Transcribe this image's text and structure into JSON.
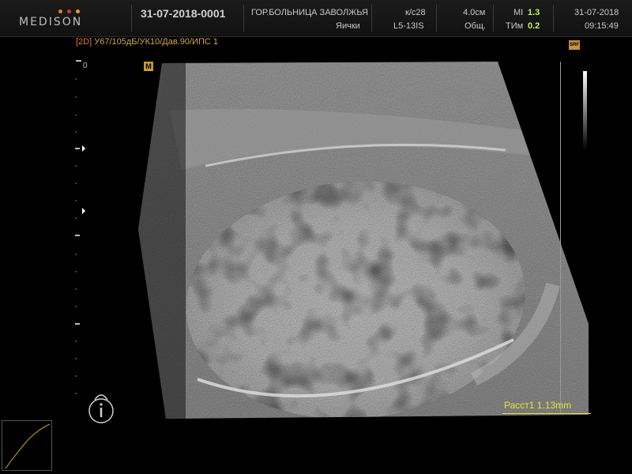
{
  "header": {
    "brand": "MEDISON",
    "brand_dot_colors": [
      "#e07a2b",
      "#d33b2b",
      "#e0a02b"
    ],
    "patient_id": "31-07-2018-0001",
    "hospital": "ГОР.БОЛЬНИЦА ЗАВОЛЖЬЯ",
    "study": "Яички",
    "kc": "к/с28",
    "probe": "L5-13IS",
    "depth": "4.0см",
    "preset": "Общ.",
    "mi_label": "MI",
    "mi_value": "1.3",
    "tim_label": "ТИм",
    "tim_value": "0.2",
    "date": "31-07-2018",
    "time": "09:15:49"
  },
  "infobar": {
    "mode": "[2D]",
    "params": "У67/105дБ/УК10/Дав.90/",
    "ips": "ИПС 1"
  },
  "image": {
    "depth_zero": "0",
    "marker_m": "M",
    "marker_srf": "SRF",
    "measurement": "Расст1 1.13mm"
  },
  "colors": {
    "measurement": "#e8e53c",
    "info_orange": "#d3a848",
    "mode_orange": "#e07c30",
    "header_value_green": "#c8f05a",
    "background": "#000000"
  },
  "icons": [
    "probe-orientation-icon",
    "post-processing-curve-icon",
    "grayscale-bar"
  ]
}
